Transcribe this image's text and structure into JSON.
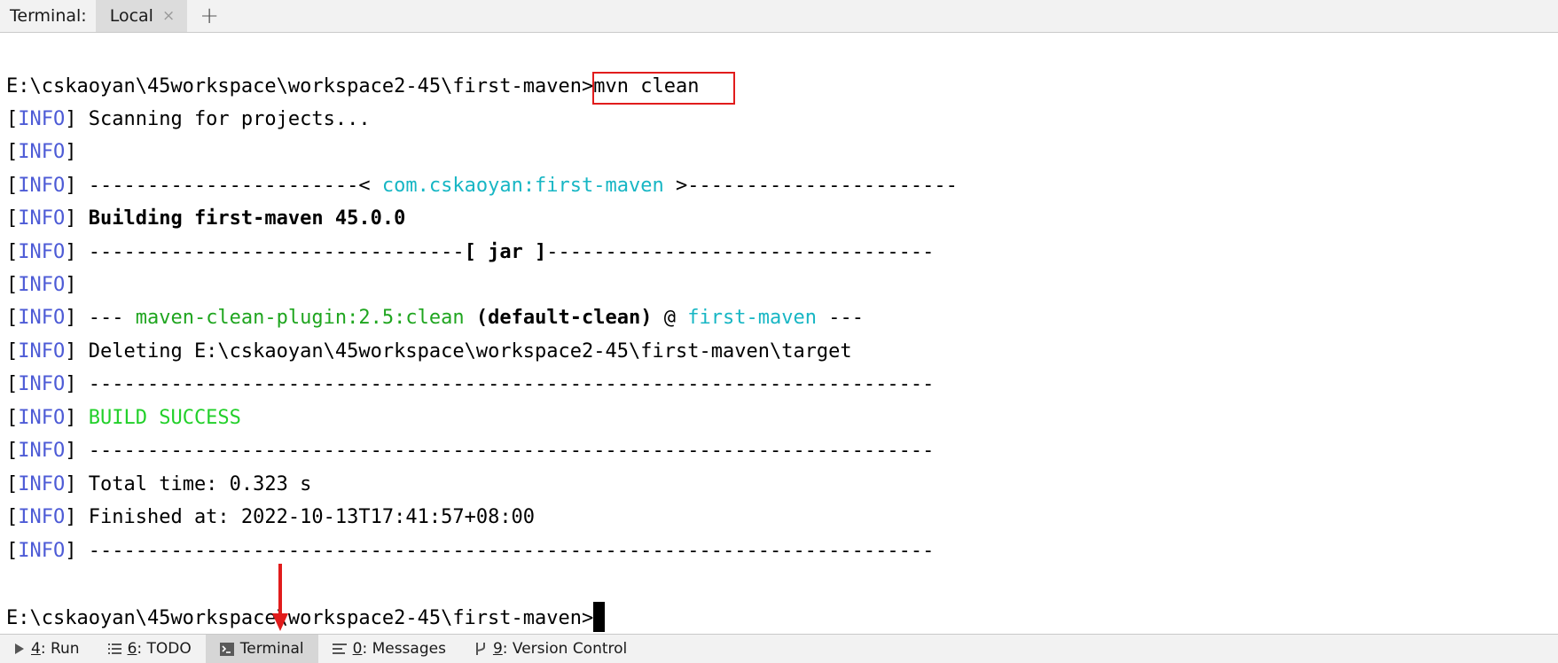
{
  "topbar": {
    "title": "Terminal:",
    "tab_label": "Local",
    "tab_close": "×",
    "add": "+"
  },
  "terminal": {
    "prompt1_path": "E:\\cskaoyan\\45workspace\\workspace2-45\\first-maven>",
    "command": "mvn clean",
    "info_tag": "INFO",
    "lines": {
      "scanning": "Scanning for projects...",
      "sep1_left": "-----------------------< ",
      "sep1_artifact": "com.cskaoyan:first-maven",
      "sep1_right": " >-----------------------",
      "building": "Building first-maven 45.0.0",
      "jar_left": "--------------------------------",
      "jar_mid": "[ jar ]",
      "jar_right": "---------------------------------",
      "plugin_dashes": "--- ",
      "plugin_name": "maven-clean-plugin:2.5:clean",
      "plugin_exec": "(default-clean)",
      "plugin_at": " @ ",
      "plugin_project": "first-maven",
      "plugin_end": " ---",
      "deleting": "Deleting E:\\cskaoyan\\45workspace\\workspace2-45\\first-maven\\target",
      "full_sep": "------------------------------------------------------------------------",
      "build_success": "BUILD SUCCESS",
      "total_time": "Total time: 0.323 s",
      "finished_at": "Finished at: 2022-10-13T17:41:57+08:00"
    },
    "prompt2_path": "E:\\cskaoyan\\45workspace\\workspace2-45\\first-maven>"
  },
  "bottombar": {
    "run_num": "4",
    "run_label": ": Run",
    "todo_num": "6",
    "todo_label": ": TODO",
    "terminal_label": "Terminal",
    "messages_num": "0",
    "messages_label": ": Messages",
    "vcs_num": "9",
    "vcs_label": ": Version Control"
  },
  "colors": {
    "info": "#4d5bd6",
    "cyan": "#17b6c4",
    "green": "#1fa51f",
    "success": "#22d02a",
    "highlight_box": "#e11c1c",
    "active_tool": "#d6d6d6"
  },
  "icons": {
    "run": "play-icon",
    "todo": "list-icon",
    "terminal": "terminal-icon",
    "messages": "messages-icon",
    "vcs": "branch-icon",
    "tab_close": "close-icon",
    "add": "plus-icon"
  }
}
